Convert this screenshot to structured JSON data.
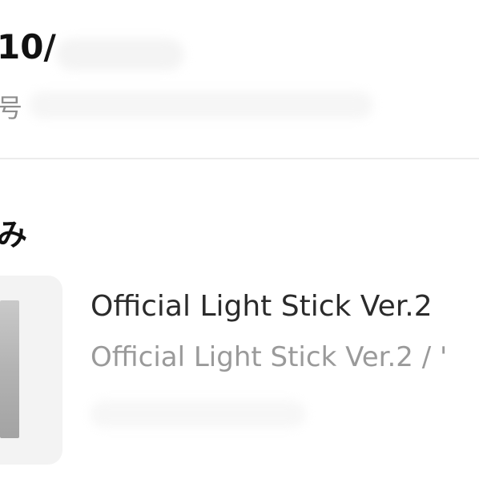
{
  "order": {
    "date_prefix": "10/",
    "number_label": "号"
  },
  "section": {
    "title": "み"
  },
  "product": {
    "name": "Official Light Stick Ver.2",
    "option": "Official Light Stick Ver.2 / '"
  }
}
